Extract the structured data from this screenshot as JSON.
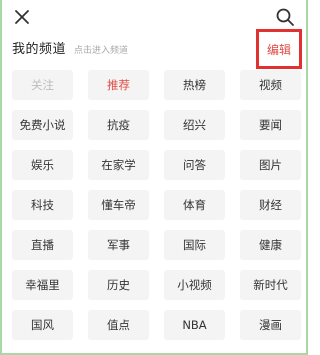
{
  "header": {
    "title": "我的频道",
    "hint": "点击进入频道",
    "edit_label": "编辑"
  },
  "channels": [
    {
      "label": "关注",
      "state": "fixed"
    },
    {
      "label": "推荐",
      "state": "active"
    },
    {
      "label": "热榜",
      "state": "normal"
    },
    {
      "label": "视频",
      "state": "normal"
    },
    {
      "label": "免费小说",
      "state": "normal"
    },
    {
      "label": "抗疫",
      "state": "normal"
    },
    {
      "label": "绍兴",
      "state": "normal"
    },
    {
      "label": "要闻",
      "state": "normal"
    },
    {
      "label": "娱乐",
      "state": "normal"
    },
    {
      "label": "在家学",
      "state": "normal"
    },
    {
      "label": "问答",
      "state": "normal"
    },
    {
      "label": "图片",
      "state": "normal"
    },
    {
      "label": "科技",
      "state": "normal"
    },
    {
      "label": "懂车帝",
      "state": "normal"
    },
    {
      "label": "体育",
      "state": "normal"
    },
    {
      "label": "财经",
      "state": "normal"
    },
    {
      "label": "直播",
      "state": "normal"
    },
    {
      "label": "军事",
      "state": "normal"
    },
    {
      "label": "国际",
      "state": "normal"
    },
    {
      "label": "健康",
      "state": "normal"
    },
    {
      "label": "幸福里",
      "state": "normal"
    },
    {
      "label": "历史",
      "state": "normal"
    },
    {
      "label": "小视频",
      "state": "normal"
    },
    {
      "label": "新时代",
      "state": "normal"
    },
    {
      "label": "国风",
      "state": "normal"
    },
    {
      "label": "值点",
      "state": "normal"
    },
    {
      "label": "NBA",
      "state": "normal"
    },
    {
      "label": "漫画",
      "state": "normal"
    }
  ],
  "icons": {
    "close": "close-icon",
    "search": "search-icon"
  },
  "colors": {
    "accent_red": "#e04b45",
    "highlight_border": "#e0332f",
    "chip_background": "#f4f4f4",
    "fixed_text": "#bdbdbd",
    "frame_border": "#a8d8a6"
  }
}
